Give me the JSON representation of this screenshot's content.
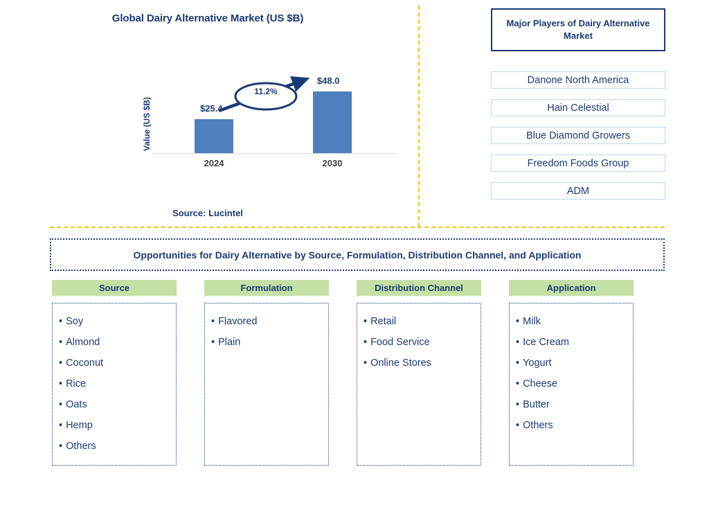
{
  "chart_panel": {
    "title": "Global Dairy Alternative Market (US $B)",
    "source_note": "Source: Lucintel"
  },
  "chart_data": {
    "type": "bar",
    "title": "Global Dairy Alternative Market (US $B)",
    "xlabel": "",
    "ylabel": "Value (US $B)",
    "categories": [
      "2024",
      "2030"
    ],
    "values": [
      25.4,
      48.0
    ],
    "value_labels": [
      "$25.4",
      "$48.0"
    ],
    "ylim": [
      0,
      53
    ],
    "grid": false,
    "legend": "none",
    "bar_color": "#4e80bd",
    "annotation": {
      "label": "11.2%",
      "kind": "cagr-arrow-ellipse",
      "from_category": "2024",
      "to_category": "2030"
    }
  },
  "players": {
    "header": "Major Players of Dairy Alternative Market",
    "items": [
      "Danone North America",
      "Hain Celestial",
      "Blue Diamond Growers",
      "Freedom Foods Group",
      "ADM"
    ]
  },
  "opportunities": {
    "banner": "Opportunities for Dairy Alternative by Source, Formulation, Distribution Channel, and Application",
    "columns": [
      {
        "header": "Source",
        "items": [
          "Soy",
          "Almond",
          "Coconut",
          "Rice",
          "Oats",
          "Hemp",
          "Others"
        ]
      },
      {
        "header": "Formulation",
        "items": [
          "Flavored",
          "Plain"
        ]
      },
      {
        "header": "Distribution Channel",
        "items": [
          "Retail",
          "Food Service",
          "Online Stores"
        ]
      },
      {
        "header": "Application",
        "items": [
          "Milk",
          "Ice Cream",
          "Yogurt",
          "Cheese",
          "Butter",
          "Others"
        ]
      }
    ]
  },
  "colors": {
    "navy": "#1b3a75",
    "bar_blue": "#4e80bd",
    "divider_yellow": "#f2c314",
    "header_green": "#c5e0a5",
    "player_border": "#bdd7ee"
  },
  "bullet": "•"
}
